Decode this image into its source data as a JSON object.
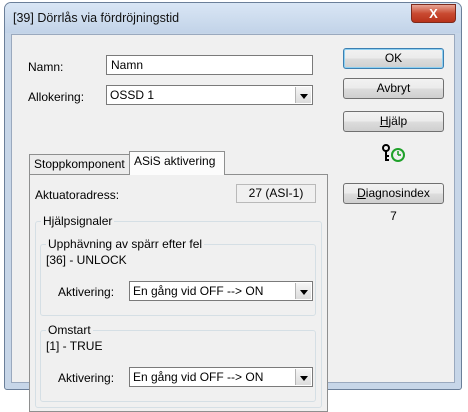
{
  "window": {
    "title": "[39] Dörrlås via fördröjningstid",
    "close_label": "X"
  },
  "form": {
    "name_label": "Namn:",
    "name_value": "Namn",
    "alloc_label": "Allokering:",
    "alloc_value": "OSSD 1"
  },
  "tabs": [
    {
      "label": "Stoppkomponent",
      "active": false
    },
    {
      "label": "ASiS aktivering",
      "active": true
    }
  ],
  "asis": {
    "actuator_label": "Aktuatoradress:",
    "actuator_value": "27 (ASI-1)",
    "helper_group": "Hjälpsignaler",
    "unlock_group": "Upphävning av spärr efter fel",
    "unlock_signal": "[36] - UNLOCK",
    "unlock_act_label": "Aktivering:",
    "unlock_act_value": "En gång vid OFF --> ON",
    "restart_group": "Omstart",
    "restart_signal": "[1] - TRUE",
    "restart_act_label": "Aktivering:",
    "restart_act_value": "En gång vid OFF --> ON"
  },
  "buttons": {
    "ok": "OK",
    "cancel": "Avbryt",
    "help_u": "H",
    "help_rest": "jälp",
    "diag_u": "D",
    "diag_rest": "iagnosindex",
    "diag_value": "7"
  },
  "icon": "lock-clock-icon",
  "colors": {
    "icon_green": "#1fa12a",
    "close_red": "#c94a31"
  }
}
